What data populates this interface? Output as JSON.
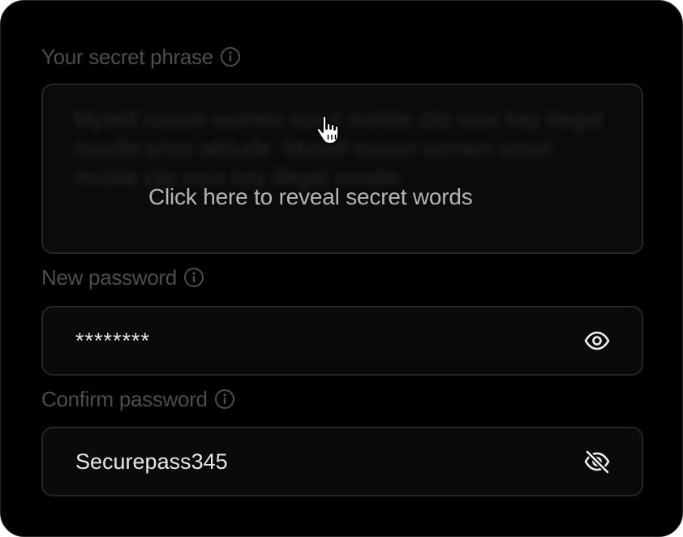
{
  "secret_phrase": {
    "label": "Your secret phrase",
    "hidden_words": "Myself cousin women scout mobile clip rose key illegal noodle price attitude. Myself cousin women scout mobile clip rose key illegal noodle",
    "reveal_prompt": "Click here to reveal secret words",
    "info_icon": "info-icon",
    "cursor_icon": "hand-pointer-icon"
  },
  "new_password": {
    "label": "New password",
    "value": "********",
    "info_icon": "info-icon",
    "toggle_icon": "eye-icon"
  },
  "confirm_password": {
    "label": "Confirm password",
    "value": "Securepass345",
    "info_icon": "info-icon",
    "toggle_icon": "eye-off-icon"
  },
  "colors": {
    "background": "#000000",
    "label": "#4d4d4d",
    "field_border": "#262626",
    "value_text": "#e6e6e6"
  }
}
